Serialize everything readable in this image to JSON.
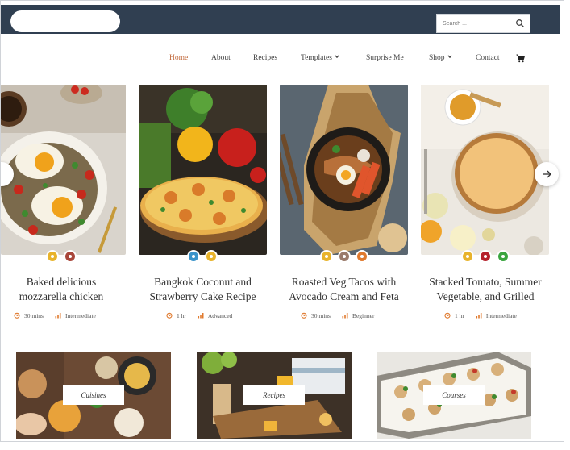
{
  "header": {
    "search_placeholder": "Search ..."
  },
  "nav": {
    "items": [
      "Home",
      "About",
      "Recipes",
      "Templates",
      "Surprise Me",
      "Shop",
      "Contact"
    ],
    "active": "Home"
  },
  "cards": [
    {
      "title": "Baked delicious\nmozzarella chicken",
      "time": "30 mins",
      "level": "Intermediate",
      "tags": [
        "#e8b32b",
        "#a9473b"
      ]
    },
    {
      "title": "Bangkok Coconut and\nStrawberry Cake Recipe",
      "time": "1 hr",
      "level": "Advanced",
      "tags": [
        "#3a93c9",
        "#e8b32b"
      ]
    },
    {
      "title": "Roasted Veg Tacos with\nAvocado Cream and Feta",
      "time": "30 mins",
      "level": "Beginner",
      "tags": [
        "#e8b32b",
        "#9a7b6b",
        "#e07a2e"
      ]
    },
    {
      "title": "Stacked Tomato, Summer\nVegetable, and Grilled",
      "time": "1 hr",
      "level": "Intermediate",
      "tags": [
        "#e8b32b",
        "#b5202a",
        "#3aa53f"
      ]
    }
  ],
  "categories": [
    "Cuisines",
    "Recipes",
    "Courses"
  ],
  "colors": {
    "topbar": "#303f51",
    "accent": "#c26a3d",
    "meta_icon": "#e07a2e"
  }
}
